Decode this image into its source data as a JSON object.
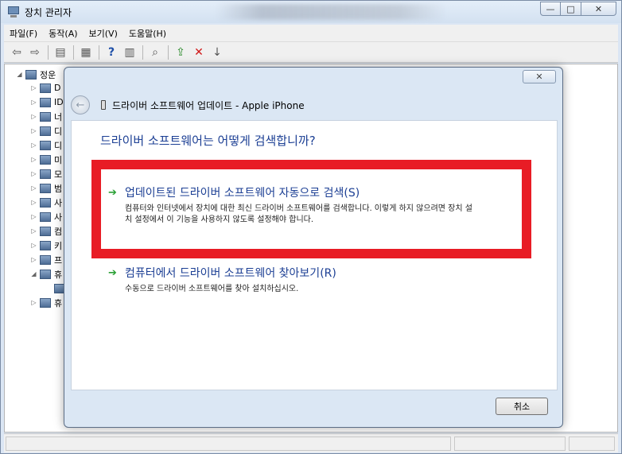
{
  "window": {
    "title": "장치 관리자",
    "controls": {
      "minimize": "—",
      "maximize": "□",
      "close": "✕"
    }
  },
  "menu": [
    "파일(F)",
    "동작(A)",
    "보기(V)",
    "도움말(H)"
  ],
  "toolbar_icons": [
    "back-arrow-icon",
    "forward-arrow-icon",
    "properties-icon",
    "refresh-list-icon",
    "help-icon",
    "view-icon",
    "scan-hardware-icon",
    "update-driver-icon",
    "uninstall-icon",
    "disable-icon"
  ],
  "tree": {
    "root": "정운",
    "items": [
      "D",
      "ID",
      "너",
      "디",
      "디",
      "미",
      "모",
      "범",
      "사",
      "사",
      "컴",
      "키",
      "프",
      "휴",
      "",
      "휴"
    ]
  },
  "dialog": {
    "close_label": "✕",
    "title": "드라이버 소프트웨어 업데이트 - Apple iPhone",
    "question": "드라이버 소프트웨어는 어떻게 검색합니까?",
    "option_auto": {
      "title": "업데이트된 드라이버 소프트웨어 자동으로 검색(S)",
      "desc": "컴퓨터와 인터넷에서 장치에 대한 최신 드라이버 소프트웨어를 검색합니다. 이렇게 하지 않으려면 장치 설치 설정에서 이 기능을 사용하지 않도록 설정해야 합니다."
    },
    "option_browse": {
      "title": "컴퓨터에서 드라이버 소프트웨어 찾아보기(R)",
      "desc": "수동으로 드라이버 소프트웨어를 찾아 설치하십시오."
    },
    "cancel_label": "취소"
  },
  "colors": {
    "highlight": "#e81c25",
    "link_text": "#1c3f94",
    "arrow": "#2aa035"
  }
}
